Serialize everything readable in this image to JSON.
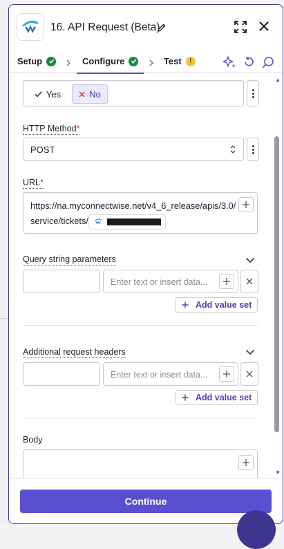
{
  "header": {
    "title": "16. API Request (Beta)",
    "app_icon": "connectwise-logo-icon",
    "edit_icon": "pencil-icon",
    "expand_icon": "expand-icon",
    "close_icon": "close-icon"
  },
  "tabs": [
    {
      "label": "Setup",
      "status": "complete"
    },
    {
      "label": "Configure",
      "status": "complete",
      "active": true
    },
    {
      "label": "Test",
      "status": "warning",
      "status_symbol": "!"
    }
  ],
  "toolbar": {
    "icons": [
      "sparkle-icon",
      "undo-icon",
      "search-icon"
    ]
  },
  "yes_no": {
    "yes_label": "Yes",
    "no_label": "No",
    "selected": "No"
  },
  "http_method": {
    "label": "HTTP Method",
    "required_mark": "*",
    "value": "POST"
  },
  "url": {
    "label": "URL",
    "required_mark": "*",
    "value": "https://na.myconnectwise.net/v4_6_release/apis/3.0/service/tickets/",
    "pill_icon": "connectwise-logo-icon"
  },
  "query_params": {
    "label": "Query string parameters",
    "value_placeholder": "Enter text or insert data...",
    "add_label": "Add value set"
  },
  "headers": {
    "label": "Additional request headers",
    "value_placeholder": "Enter text or insert data...",
    "add_label": "Add value set"
  },
  "body": {
    "label": "Body"
  },
  "footer": {
    "continue_label": "Continue"
  },
  "colors": {
    "accent": "#5b4fd1",
    "border": "#3f3591",
    "success": "#1a8a3e",
    "warning": "#f2c62f",
    "required": "#d6394b"
  }
}
